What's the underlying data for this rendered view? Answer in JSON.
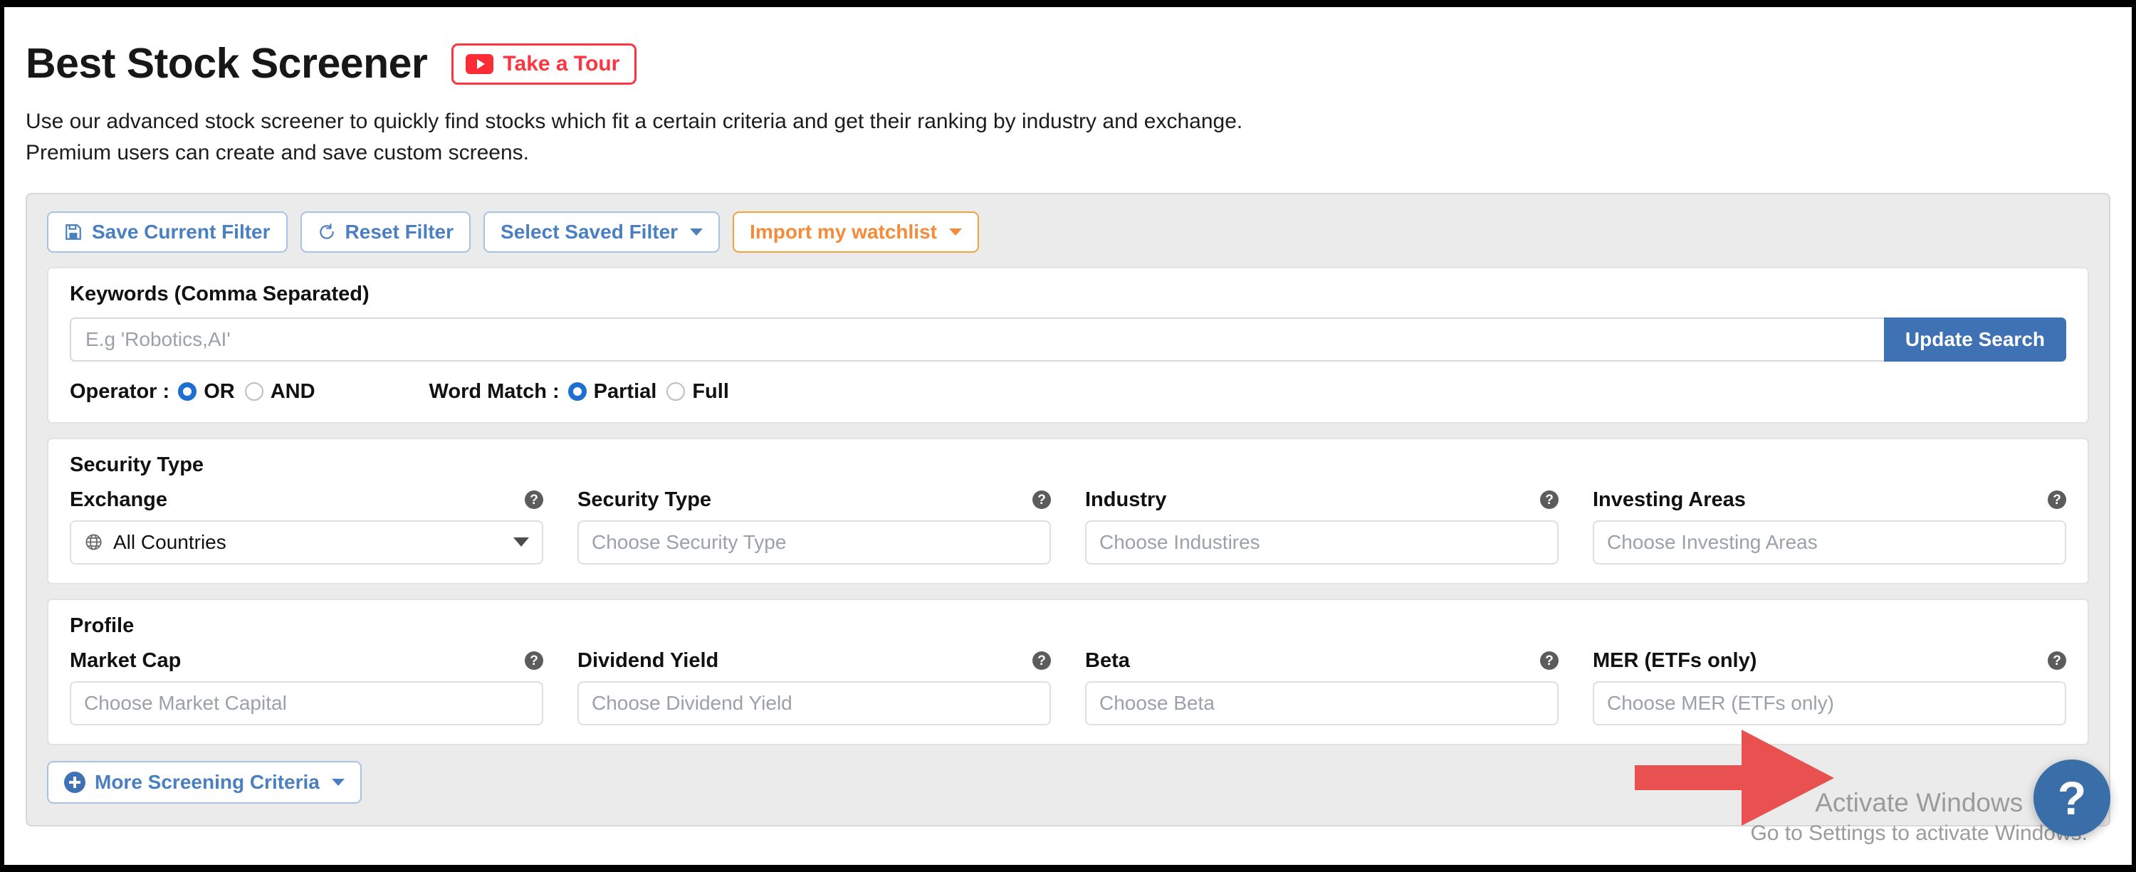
{
  "header": {
    "title": "Best Stock Screener",
    "tour_button": "Take a Tour",
    "description_line1": "Use our advanced stock screener to quickly find stocks which fit a certain criteria and get their ranking by industry and exchange.",
    "description_line2": "Premium users can create and save custom screens."
  },
  "toolbar": {
    "save_filter": "Save Current Filter",
    "reset_filter": "Reset Filter",
    "select_saved_filter": "Select Saved Filter",
    "import_watchlist": "Import my watchlist"
  },
  "keywords": {
    "heading": "Keywords (Comma Separated)",
    "input_value": "",
    "input_placeholder": "E.g 'Robotics,AI'",
    "update_button": "Update Search",
    "operator_label": "Operator :",
    "operator_options": [
      "OR",
      "AND"
    ],
    "operator_selected": "OR",
    "word_match_label": "Word Match :",
    "word_match_options": [
      "Partial",
      "Full"
    ],
    "word_match_selected": "Partial"
  },
  "security_type": {
    "heading": "Security Type",
    "fields": [
      {
        "label": "Exchange",
        "type": "select",
        "value": "All Countries",
        "icon": "globe-icon"
      },
      {
        "label": "Security Type",
        "type": "input",
        "placeholder": "Choose Security Type",
        "value": ""
      },
      {
        "label": "Industry",
        "type": "input",
        "placeholder": "Choose Industires",
        "value": ""
      },
      {
        "label": "Investing Areas",
        "type": "input",
        "placeholder": "Choose Investing Areas",
        "value": ""
      }
    ]
  },
  "profile": {
    "heading": "Profile",
    "fields": [
      {
        "label": "Market Cap",
        "type": "input",
        "placeholder": "Choose Market Capital",
        "value": ""
      },
      {
        "label": "Dividend Yield",
        "type": "input",
        "placeholder": "Choose Dividend Yield",
        "value": ""
      },
      {
        "label": "Beta",
        "type": "input",
        "placeholder": "Choose Beta",
        "value": ""
      },
      {
        "label": "MER (ETFs only)",
        "type": "input",
        "placeholder": "Choose MER (ETFs only)",
        "value": ""
      }
    ]
  },
  "footer": {
    "more_criteria": "More Screening Criteria"
  },
  "watermark": {
    "line1": "Activate Windows",
    "line2": "Go to Settings to activate Windows."
  },
  "help_fab": {
    "label": "?"
  },
  "colors": {
    "accent_blue": "#3f72b5",
    "accent_orange": "#f58b38",
    "tour_red": "#fb3640",
    "arrow_red": "#e8514f",
    "panel_bg": "#ebebeb"
  }
}
